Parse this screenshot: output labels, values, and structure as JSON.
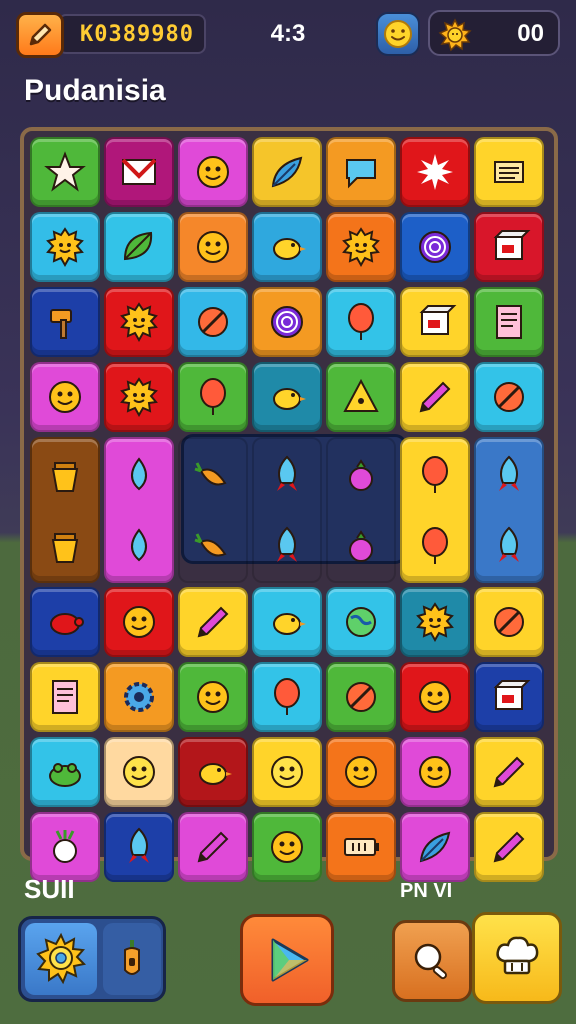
{
  "header": {
    "score": "K0389980",
    "timer": "4:3",
    "coins": "00",
    "title": "Pudanisia",
    "pencil_icon": "pencil-icon",
    "coin_icon": "smiley-coin-icon",
    "sun_icon": "sun-icon"
  },
  "board": {
    "rows": 9,
    "cols": 7,
    "tiles": [
      {
        "color": "#4fb83a",
        "icon": "star"
      },
      {
        "color": "#b0177a",
        "icon": "envelope"
      },
      {
        "color": "#e04ad8",
        "icon": "face"
      },
      {
        "color": "#f5c52a",
        "icon": "feather"
      },
      {
        "color": "#f49a22",
        "icon": "speech-bubble"
      },
      {
        "color": "#e0161a",
        "icon": "burst"
      },
      {
        "color": "#ffd42a",
        "icon": "papers"
      },
      {
        "color": "#33bde8",
        "icon": "sun-face"
      },
      {
        "color": "#33c3e8",
        "icon": "leaf"
      },
      {
        "color": "#f5872a",
        "icon": "face"
      },
      {
        "color": "#2fa8de",
        "icon": "bird"
      },
      {
        "color": "#f4741a",
        "icon": "sun-face"
      },
      {
        "color": "#1d5fc8",
        "icon": "swirl"
      },
      {
        "color": "#d8162a",
        "icon": "box"
      },
      {
        "color": "#1d3fa8",
        "icon": "hammer"
      },
      {
        "color": "#e0161a",
        "icon": "sun-face"
      },
      {
        "color": "#33b8e8",
        "icon": "ball"
      },
      {
        "color": "#f49a22",
        "icon": "swirl"
      },
      {
        "color": "#33c3e8",
        "icon": "balloon"
      },
      {
        "color": "#ffd42a",
        "icon": "box"
      },
      {
        "color": "#4fb83a",
        "icon": "document"
      },
      {
        "color": "#e04ad8",
        "icon": "face"
      },
      {
        "color": "#e0161a",
        "icon": "sun-face"
      },
      {
        "color": "#4fb83a",
        "icon": "balloon"
      },
      {
        "color": "#1f8aa8",
        "icon": "bird"
      },
      {
        "color": "#4fb83a",
        "icon": "triangle"
      },
      {
        "color": "#ffd42a",
        "icon": "pencil"
      },
      {
        "color": "#33c3e8",
        "icon": "ball"
      },
      {
        "color": "#8a4a14",
        "icon": "pot",
        "tall": true
      },
      {
        "color": "#e04ad8",
        "icon": "drop",
        "tall": true
      },
      {
        "color": "transparent",
        "icon": "carrot",
        "flat": true
      },
      {
        "color": "transparent",
        "icon": "rocket",
        "flat": true
      },
      {
        "color": "transparent",
        "icon": "berry",
        "flat": true
      },
      {
        "color": "#ffd42a",
        "icon": "balloon",
        "tall": true
      },
      {
        "color": "#3a78c8",
        "icon": "rocket",
        "tall": true
      },
      {
        "color": "#1d3fa8",
        "icon": "turtle"
      },
      {
        "color": "#e0161a",
        "icon": "face"
      },
      {
        "color": "#ffd42a",
        "icon": "pencil"
      },
      {
        "color": "#33c3e8",
        "icon": "bird"
      },
      {
        "color": "#33c3e8",
        "icon": "globe"
      },
      {
        "color": "#1f8aa8",
        "icon": "sun-face"
      },
      {
        "color": "#ffd42a",
        "icon": "ball"
      },
      {
        "color": "#ffd42a",
        "icon": "document"
      },
      {
        "color": "#f49a22",
        "icon": "gear"
      },
      {
        "color": "#4fb83a",
        "icon": "face"
      },
      {
        "color": "#33c3e8",
        "icon": "balloon"
      },
      {
        "color": "#4fb83a",
        "icon": "ball"
      },
      {
        "color": "#e0161a",
        "icon": "face"
      },
      {
        "color": "#1d3fa8",
        "icon": "box"
      },
      {
        "color": "#33c3e8",
        "icon": "frog"
      },
      {
        "color": "#ffd9a0",
        "icon": "face"
      },
      {
        "color": "#b3161a",
        "icon": "bird"
      },
      {
        "color": "#ffd42a",
        "icon": "face"
      },
      {
        "color": "#f4741a",
        "icon": "face"
      },
      {
        "color": "#e04ad8",
        "icon": "face"
      },
      {
        "color": "#ffd42a",
        "icon": "pencil"
      },
      {
        "color": "#e04ad8",
        "icon": "radish"
      },
      {
        "color": "#1d3fa8",
        "icon": "rocket"
      },
      {
        "color": "#e04ad8",
        "icon": "pencil"
      },
      {
        "color": "#4fb83a",
        "icon": "face"
      },
      {
        "color": "#f4741a",
        "icon": "battery"
      },
      {
        "color": "#e04ad8",
        "icon": "feather"
      },
      {
        "color": "#ffd42a",
        "icon": "pencil"
      }
    ]
  },
  "footer": {
    "left_label": "SUII",
    "right_label": "PN VI",
    "left_icons": [
      "sun-icon",
      "pepper-icon"
    ],
    "play_icon": "play-icon",
    "right_icons": [
      "magnifier-icon",
      "chef-hat-icon"
    ]
  }
}
